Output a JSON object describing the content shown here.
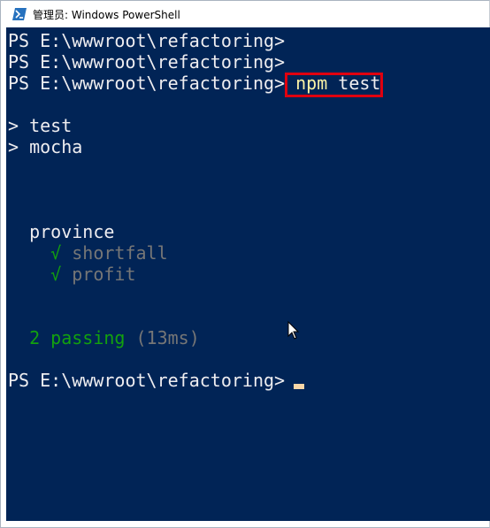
{
  "window": {
    "title": "管理员: Windows PowerShell",
    "icon": "powershell-icon"
  },
  "console": {
    "prompt1": "PS E:\\wwwroot\\refactoring>",
    "prompt2": "PS E:\\wwwroot\\refactoring>",
    "prompt3": "PS E:\\wwwroot\\refactoring>",
    "command": "npm test",
    "command_npm": "npm",
    "command_arg": "test",
    "out_test": "> test",
    "out_mocha": "> mocha",
    "suite": "province",
    "check_mark": "√",
    "test1": "shortfall",
    "test2": "profit",
    "passing": "2 passing",
    "duration": "(13ms)",
    "final_prompt": "PS E:\\wwwroot\\refactoring>"
  },
  "colors": {
    "background": "#012456",
    "text": "#eeedf0",
    "pass_green": "#13a10e",
    "dim_gray": "#767676",
    "highlight_box": "#e0000f",
    "command_yellow": "#f9f1a5"
  }
}
